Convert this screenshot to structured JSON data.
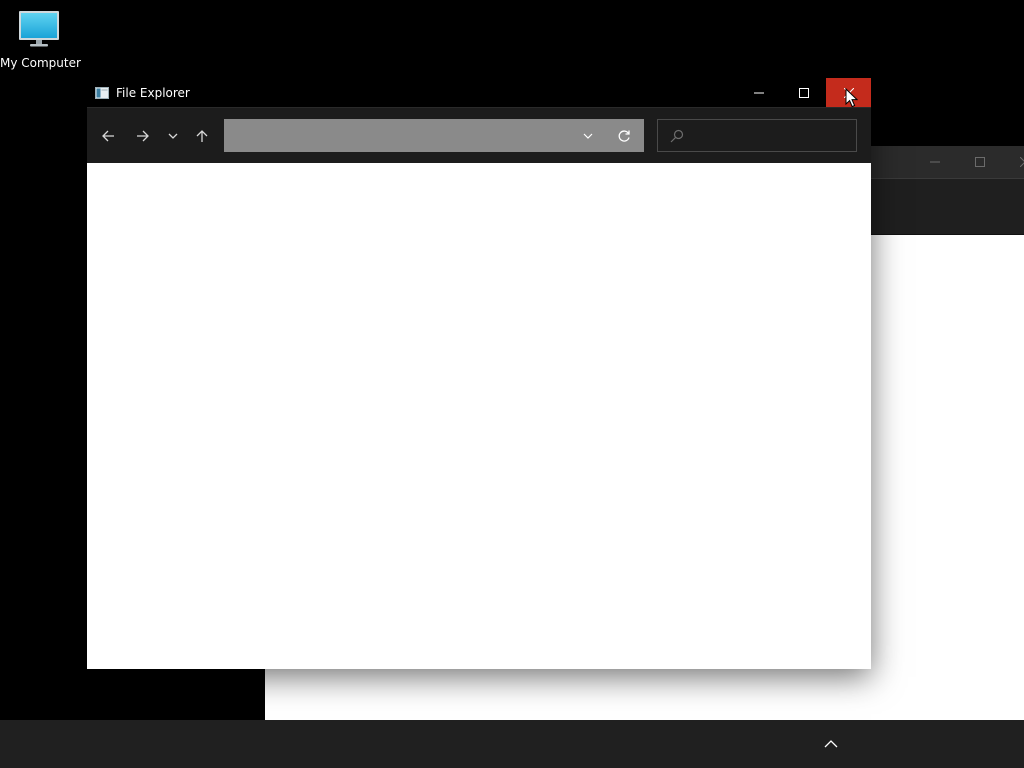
{
  "desktop": {
    "background_color": "#000000",
    "icons": [
      {
        "label": "My Computer",
        "icon": "monitor-icon"
      }
    ]
  },
  "background_window": {
    "title": "",
    "controls": [
      "minimize-icon",
      "maximize-icon",
      "close-icon"
    ]
  },
  "window": {
    "title": "File Explorer",
    "app_icon": "explorer-window-icon",
    "controls": {
      "minimize": "minimize-icon",
      "maximize": "maximize-icon",
      "close": "close-icon",
      "close_hover_color": "#c42b1c"
    },
    "toolbar": {
      "nav": [
        "back-arrow-icon",
        "forward-arrow-icon",
        "recent-locations-chevron-icon",
        "up-arrow-icon"
      ],
      "address": {
        "value": "",
        "dropdown_icon": "chevron-down-icon",
        "refresh_icon": "refresh-icon"
      },
      "search": {
        "value": "",
        "placeholder": "",
        "icon": "search-icon"
      }
    },
    "content": {
      "items": []
    }
  },
  "taskbar": {
    "background_color": "#202020",
    "tray": [
      "show-hidden-icons-chevron-up-icon"
    ]
  },
  "cursor": {
    "type": "arrow-pointer",
    "over": "close-button"
  }
}
